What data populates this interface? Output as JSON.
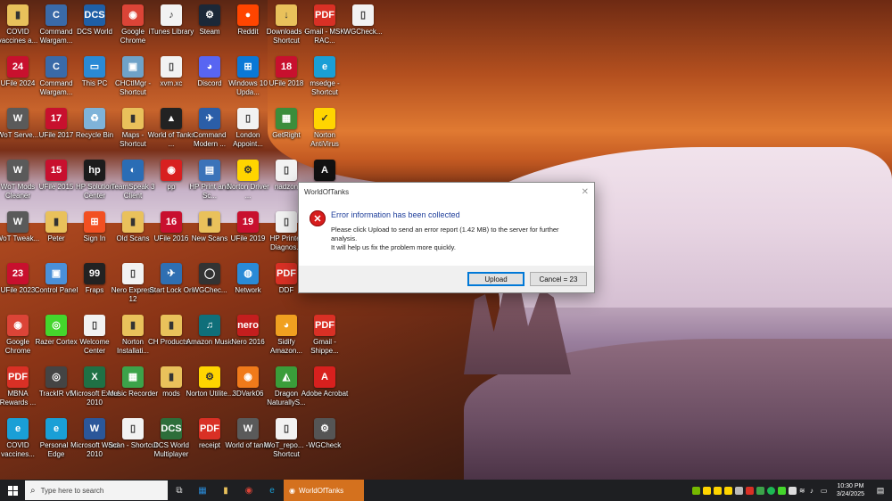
{
  "desktop": {
    "icons": [
      {
        "label": "COVID vaccines a...",
        "glyph": "▮",
        "color": "#e9c15b",
        "x": 0,
        "y": 0
      },
      {
        "label": "Command Wargam...",
        "glyph": "C",
        "color": "#3a6aa8",
        "x": 1,
        "y": 0
      },
      {
        "label": "DCS World",
        "glyph": "DCS",
        "color": "#1f5fa6",
        "x": 2,
        "y": 0
      },
      {
        "label": "Google Chrome",
        "glyph": "◉",
        "color": "#db4437",
        "x": 3,
        "y": 0
      },
      {
        "label": "iTunes Library",
        "glyph": "♪",
        "color": "#f2f2f2",
        "x": 4,
        "y": 0
      },
      {
        "label": "Steam",
        "glyph": "⚙",
        "color": "#1b2838",
        "x": 5,
        "y": 0
      },
      {
        "label": "Reddit",
        "glyph": "●",
        "color": "#ff4500",
        "x": 6,
        "y": 0
      },
      {
        "label": "Downloads - Shortcut",
        "glyph": "↓",
        "color": "#e9c15b",
        "x": 7,
        "y": 0
      },
      {
        "label": "Gmail - MSK RAC...",
        "glyph": "PDF",
        "color": "#d93025",
        "x": 8,
        "y": 0
      },
      {
        "label": "WGCheck...",
        "glyph": "▯",
        "color": "#f2f2f2",
        "x": 9,
        "y": 0
      },
      {
        "label": "UFile 2024",
        "glyph": "24",
        "color": "#c8102e",
        "x": 0,
        "y": 1
      },
      {
        "label": "Command Wargam...",
        "glyph": "C",
        "color": "#3a6aa8",
        "x": 1,
        "y": 1
      },
      {
        "label": "This PC",
        "glyph": "▭",
        "color": "#2a8ad6",
        "x": 2,
        "y": 1
      },
      {
        "label": "CHCtlMgr - Shortcut",
        "glyph": "▣",
        "color": "#6fa2c8",
        "x": 3,
        "y": 1
      },
      {
        "label": "xvm.xc",
        "glyph": "▯",
        "color": "#f2f2f2",
        "x": 4,
        "y": 1
      },
      {
        "label": "Discord",
        "glyph": "◕",
        "color": "#5865f2",
        "x": 5,
        "y": 1
      },
      {
        "label": "Windows 10 Upda...",
        "glyph": "⊞",
        "color": "#0a78d7",
        "x": 6,
        "y": 1
      },
      {
        "label": "UFile 2018",
        "glyph": "18",
        "color": "#c8102e",
        "x": 7,
        "y": 1
      },
      {
        "label": "msedge - Shortcut",
        "glyph": "e",
        "color": "#1a9fd6",
        "x": 8,
        "y": 1
      },
      {
        "label": "WoT Serve...",
        "glyph": "W",
        "color": "#5a5a5a",
        "x": 0,
        "y": 2
      },
      {
        "label": "UFile 2017",
        "glyph": "17",
        "color": "#c8102e",
        "x": 1,
        "y": 2
      },
      {
        "label": "Recycle Bin",
        "glyph": "♻",
        "color": "#7fb3d9",
        "x": 2,
        "y": 2
      },
      {
        "label": "Maps - Shortcut",
        "glyph": "▮",
        "color": "#e9c15b",
        "x": 3,
        "y": 2
      },
      {
        "label": "World of Tanks ...",
        "glyph": "▲",
        "color": "#222222",
        "x": 4,
        "y": 2
      },
      {
        "label": "Command Modern ...",
        "glyph": "✈",
        "color": "#2b5ea8",
        "x": 5,
        "y": 2
      },
      {
        "label": "London Appoint...",
        "glyph": "▯",
        "color": "#f2f2f2",
        "x": 6,
        "y": 2
      },
      {
        "label": "GetRight",
        "glyph": "▦",
        "color": "#3b8d3b",
        "x": 7,
        "y": 2
      },
      {
        "label": "Norton AntiVirus",
        "glyph": "✓",
        "color": "#ffd500",
        "x": 8,
        "y": 2
      },
      {
        "label": "WoT Mods Cleaner",
        "glyph": "W",
        "color": "#5a5a5a",
        "x": 0,
        "y": 3
      },
      {
        "label": "UFile 2015",
        "glyph": "15",
        "color": "#c8102e",
        "x": 1,
        "y": 3
      },
      {
        "label": "HP Solution Center",
        "glyph": "hp",
        "color": "#1c1c1c",
        "x": 2,
        "y": 3
      },
      {
        "label": "TeamSpeak 3 Client",
        "glyph": "◐",
        "color": "#2a6db5",
        "x": 3,
        "y": 3
      },
      {
        "label": "pp",
        "glyph": "◉",
        "color": "#d82020",
        "x": 4,
        "y": 3
      },
      {
        "label": "HP Print and Sc...",
        "glyph": "▤",
        "color": "#3b73b9",
        "x": 5,
        "y": 3
      },
      {
        "label": "Norton Driver ...",
        "glyph": "⚙",
        "color": "#ffd500",
        "x": 6,
        "y": 3
      },
      {
        "label": "nadzon",
        "glyph": "▯",
        "color": "#f2f2f2",
        "x": 7,
        "y": 3
      },
      {
        "label": "",
        "glyph": "A",
        "color": "#111111",
        "x": 8,
        "y": 3
      },
      {
        "label": "WoT Tweak...",
        "glyph": "W",
        "color": "#5a5a5a",
        "x": 0,
        "y": 4
      },
      {
        "label": "Peter",
        "glyph": "▮",
        "color": "#e9c15b",
        "x": 1,
        "y": 4
      },
      {
        "label": "Sign In",
        "glyph": "⊞",
        "color": "#f25022",
        "x": 2,
        "y": 4
      },
      {
        "label": "Old Scans",
        "glyph": "▮",
        "color": "#e9c15b",
        "x": 3,
        "y": 4
      },
      {
        "label": "UFile 2016",
        "glyph": "16",
        "color": "#c8102e",
        "x": 4,
        "y": 4
      },
      {
        "label": "New Scans",
        "glyph": "▮",
        "color": "#e9c15b",
        "x": 5,
        "y": 4
      },
      {
        "label": "UFile 2019",
        "glyph": "19",
        "color": "#c8102e",
        "x": 6,
        "y": 4
      },
      {
        "label": "HP Printer Diagnos...",
        "glyph": "▯",
        "color": "#f2f2f2",
        "x": 7,
        "y": 4
      },
      {
        "label": "UFile 2023",
        "glyph": "23",
        "color": "#c8102e",
        "x": 0,
        "y": 5
      },
      {
        "label": "Control Panel",
        "glyph": "▣",
        "color": "#4a90d9",
        "x": 1,
        "y": 5
      },
      {
        "label": "Fraps",
        "glyph": "99",
        "color": "#222222",
        "x": 2,
        "y": 5
      },
      {
        "label": "Nero Express 12",
        "glyph": "▯",
        "color": "#f2f2f2",
        "x": 3,
        "y": 5
      },
      {
        "label": "Start Lock On",
        "glyph": "✈",
        "color": "#2f6fb2",
        "x": 4,
        "y": 5
      },
      {
        "label": "WGChec...",
        "glyph": "◯",
        "color": "#333333",
        "x": 5,
        "y": 5
      },
      {
        "label": "Network",
        "glyph": "◍",
        "color": "#2a8ad6",
        "x": 6,
        "y": 5
      },
      {
        "label": "DDF",
        "glyph": "PDF",
        "color": "#d93025",
        "x": 7,
        "y": 5
      },
      {
        "label": "Google Chrome",
        "glyph": "◉",
        "color": "#db4437",
        "x": 0,
        "y": 6
      },
      {
        "label": "Razer Cortex",
        "glyph": "◎",
        "color": "#44d62c",
        "x": 1,
        "y": 6
      },
      {
        "label": "Welcome Center",
        "glyph": "▯",
        "color": "#f2f2f2",
        "x": 2,
        "y": 6
      },
      {
        "label": "Norton Installati...",
        "glyph": "▮",
        "color": "#e9c15b",
        "x": 3,
        "y": 6
      },
      {
        "label": "CH Products...",
        "glyph": "▮",
        "color": "#e9c15b",
        "x": 4,
        "y": 6
      },
      {
        "label": "Amazon Music",
        "glyph": "♫",
        "color": "#0f6f7a",
        "x": 5,
        "y": 6
      },
      {
        "label": "Nero 2016",
        "glyph": "nero",
        "color": "#c41e1e",
        "x": 6,
        "y": 6
      },
      {
        "label": "Sidify Amazon...",
        "glyph": "◕",
        "color": "#f0a020",
        "x": 7,
        "y": 6
      },
      {
        "label": "Gmail - Shippe...",
        "glyph": "PDF",
        "color": "#d93025",
        "x": 8,
        "y": 6
      },
      {
        "label": "MBNA Rewards ...",
        "glyph": "PDF",
        "color": "#d93025",
        "x": 0,
        "y": 7
      },
      {
        "label": "TrackIR v5",
        "glyph": "◎",
        "color": "#444444",
        "x": 1,
        "y": 7
      },
      {
        "label": "Microsoft Excel 2010",
        "glyph": "X",
        "color": "#1f7145",
        "x": 2,
        "y": 7
      },
      {
        "label": "Music Recorder",
        "glyph": "▦",
        "color": "#3ca34a",
        "x": 3,
        "y": 7
      },
      {
        "label": "mods",
        "glyph": "▮",
        "color": "#e9c15b",
        "x": 4,
        "y": 7
      },
      {
        "label": "Norton Utilite...",
        "glyph": "⚙",
        "color": "#ffd500",
        "x": 5,
        "y": 7
      },
      {
        "label": "3DVark06",
        "glyph": "◉",
        "color": "#f07a1a",
        "x": 6,
        "y": 7
      },
      {
        "label": "Dragon NaturallyS...",
        "glyph": "◭",
        "color": "#3a9d3a",
        "x": 7,
        "y": 7
      },
      {
        "label": "Adobe Acrobat",
        "glyph": "A",
        "color": "#d8201e",
        "x": 8,
        "y": 7
      },
      {
        "label": "COVID vaccines...",
        "glyph": "e",
        "color": "#1a9fd6",
        "x": 0,
        "y": 8
      },
      {
        "label": "Personal - Edge",
        "glyph": "e",
        "color": "#1a9fd6",
        "x": 1,
        "y": 8
      },
      {
        "label": "Microsoft Word 2010",
        "glyph": "W",
        "color": "#2b579a",
        "x": 2,
        "y": 8
      },
      {
        "label": "Scan - Shortcut",
        "glyph": "▯",
        "color": "#f2f2f2",
        "x": 3,
        "y": 8
      },
      {
        "label": "DCS World Multiplayer",
        "glyph": "DCS",
        "color": "#2d6e3a",
        "x": 4,
        "y": 8
      },
      {
        "label": "receipt",
        "glyph": "PDF",
        "color": "#d93025",
        "x": 5,
        "y": 8
      },
      {
        "label": "World of tanks",
        "glyph": "W",
        "color": "#5a5a5a",
        "x": 6,
        "y": 8
      },
      {
        "label": "WoT_repo... - Shortcut",
        "glyph": "▯",
        "color": "#f2f2f2",
        "x": 7,
        "y": 8
      },
      {
        "label": "WGCheck",
        "glyph": "⚙",
        "color": "#555555",
        "x": 8,
        "y": 8
      }
    ]
  },
  "dialog": {
    "title": "WorldOfTanks",
    "close_glyph": "✕",
    "error_glyph": "✕",
    "heading": "Error information has been collected",
    "message_line1": "Please click Upload to send an error report (1.42 MB) to the server for further analysis.",
    "message_line2": "It will help us fix the problem more quickly.",
    "upload_label": "Upload",
    "cancel_label": "Cancel = 23"
  },
  "taskbar": {
    "search_placeholder": "Type here to search",
    "search_icon": "search-icon",
    "active_app": "WorldOfTanks",
    "time": "10:30 PM",
    "date": "3/24/2025"
  }
}
